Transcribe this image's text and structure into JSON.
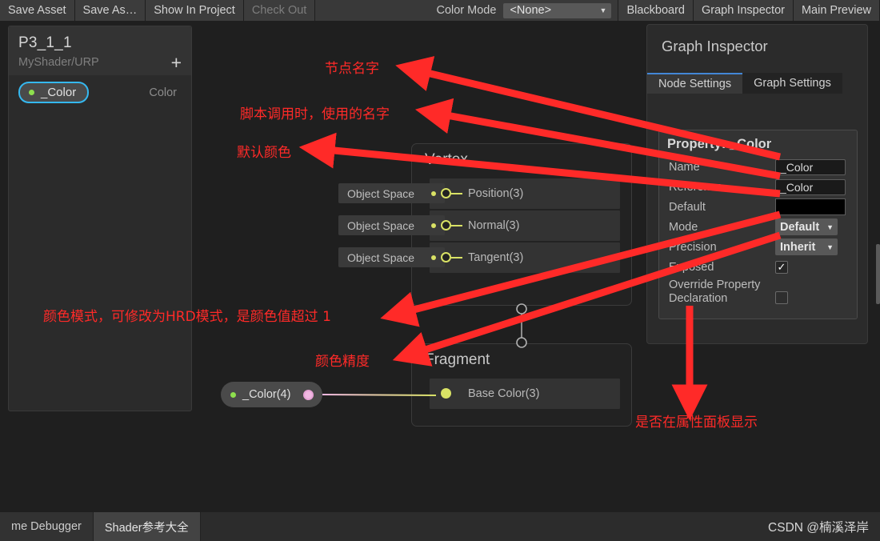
{
  "toolbar": {
    "buttons": [
      {
        "label": "Save Asset",
        "dim": false
      },
      {
        "label": "Save As…",
        "dim": false
      },
      {
        "label": "Show In Project",
        "dim": false
      },
      {
        "label": "Check Out",
        "dim": true
      }
    ],
    "color_mode_label": "Color Mode",
    "color_mode_value": "<None>",
    "right_buttons": [
      "Blackboard",
      "Graph Inspector",
      "Main Preview"
    ]
  },
  "blackboard": {
    "title": "P3_1_1",
    "subtitle": "MyShader/URP",
    "add_label": "+",
    "property": {
      "name": "_Color",
      "type": "Color"
    }
  },
  "graph": {
    "vertex": {
      "title": "Vertex",
      "slots": [
        {
          "space": "Object Space",
          "label": "Position(3)"
        },
        {
          "space": "Object Space",
          "label": "Normal(3)"
        },
        {
          "space": "Object Space",
          "label": "Tangent(3)"
        }
      ]
    },
    "fragment": {
      "title": "Fragment",
      "slots": [
        {
          "label": "Base Color(3)"
        }
      ]
    },
    "color_node": {
      "label": "_Color(4)"
    }
  },
  "inspector": {
    "title": "Graph Inspector",
    "tabs": [
      {
        "label": "Node Settings",
        "active": true
      },
      {
        "label": "Graph Settings",
        "active": false
      }
    ],
    "property_header": "Property: _Color",
    "fields": {
      "name_label": "Name",
      "name_value": "_Color",
      "reference_label": "Reference",
      "reference_value": "_Color",
      "default_label": "Default",
      "default_color": "#000000",
      "mode_label": "Mode",
      "mode_value": "Default",
      "precision_label": "Precision",
      "precision_value": "Inherit",
      "exposed_label": "Exposed",
      "exposed_checked": "✓",
      "override_label": "Override Property Declaration",
      "override_checked": ""
    }
  },
  "annotations": [
    {
      "id": "node-name",
      "text": "节点名字"
    },
    {
      "id": "script-reference",
      "text": "脚本调用时，使用的名字"
    },
    {
      "id": "default-color",
      "text": "默认颜色"
    },
    {
      "id": "color-mode",
      "text": "颜色模式，可修改为HRD模式，是颜色值超过 1"
    },
    {
      "id": "color-precision",
      "text": "颜色精度"
    },
    {
      "id": "exposed-in-inspector",
      "text": "是否在属性面板显示"
    }
  ],
  "bottombar": {
    "tabs": [
      {
        "label": "me Debugger",
        "active": false
      },
      {
        "label": "Shader参考大全",
        "active": true
      }
    ],
    "watermark": "CSDN @楠溪泽岸"
  },
  "colors": {
    "annotation_red": "#ff2a28",
    "accent_blue": "#4387d6",
    "selection_cyan": "#35b8f0",
    "port_yellow": "#d9e265",
    "port_pink": "#f0b8e2",
    "property_green": "#8ee04e"
  }
}
